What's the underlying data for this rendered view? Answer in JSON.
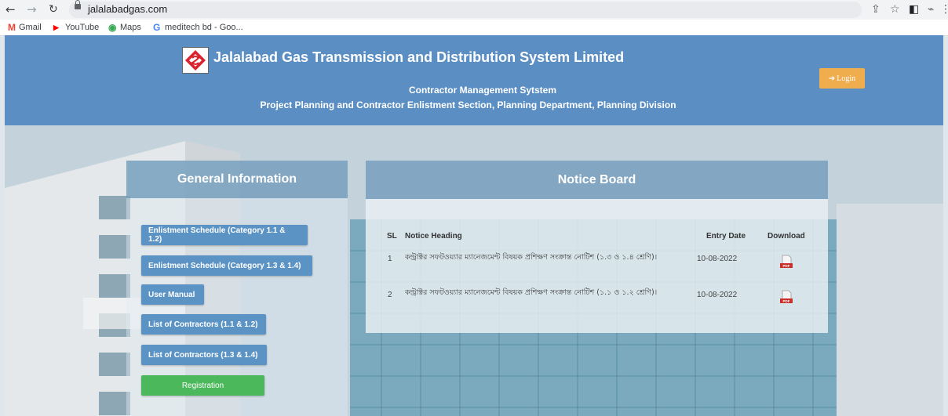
{
  "browser": {
    "url": "jalalabadgas.com",
    "bookmarks": [
      {
        "icon": "M",
        "label": "Gmail",
        "color": "#ea4335"
      },
      {
        "icon": "▶",
        "label": "YouTube",
        "color": "#ff0000"
      },
      {
        "icon": "◉",
        "label": "Maps",
        "color": "#34a853"
      },
      {
        "icon": "G",
        "label": "meditech bd - Goo...",
        "color": "#4285f4"
      }
    ]
  },
  "header": {
    "title": "Jalalabad Gas Transmission and Distribution System Limited",
    "subtitle1": "Contractor Management Sytstem",
    "subtitle2": "Project Planning and Contractor Enlistment Section, Planning Department, Planning Division",
    "login_label": "Login"
  },
  "general_info": {
    "heading": "General Information",
    "buttons": [
      "Enlistment Schedule (Category 1.1 & 1.2)",
      "Enlistment Schedule (Category 1.3 & 1.4)",
      "User Manual",
      "List of Contractors (1.1 & 1.2)",
      "List of Contractors (1.3 & 1.4)",
      "Registration"
    ]
  },
  "notice_board": {
    "heading": "Notice Board",
    "columns": [
      "SL",
      "Notice Heading",
      "Entry Date",
      "Download"
    ],
    "rows": [
      {
        "sl": "1",
        "heading": "কন্ট্রাক্টর সফটওয়্যার ম্যানেজমেন্ট বিষয়ক প্রশিক্ষণ সংক্রান্ত নোটিশ (১.৩ ও ১.৪ শ্রেণি)।",
        "date": "10-08-2022"
      },
      {
        "sl": "2",
        "heading": "কন্ট্রাক্টর সফটওয়্যার ম্যানেজমেন্ট বিষয়ক প্রশিক্ষণ সংক্রান্ত নোটিশ (১.১ ও ১.২ শ্রেণি)।",
        "date": "10-08-2022"
      }
    ]
  },
  "colors": {
    "header_bg": "#5b8fc4",
    "login_btn": "#f0ad4e",
    "side_btn": "#5b93c4",
    "register_btn": "#4cb85c",
    "pdf_icon": "#c9302c"
  }
}
